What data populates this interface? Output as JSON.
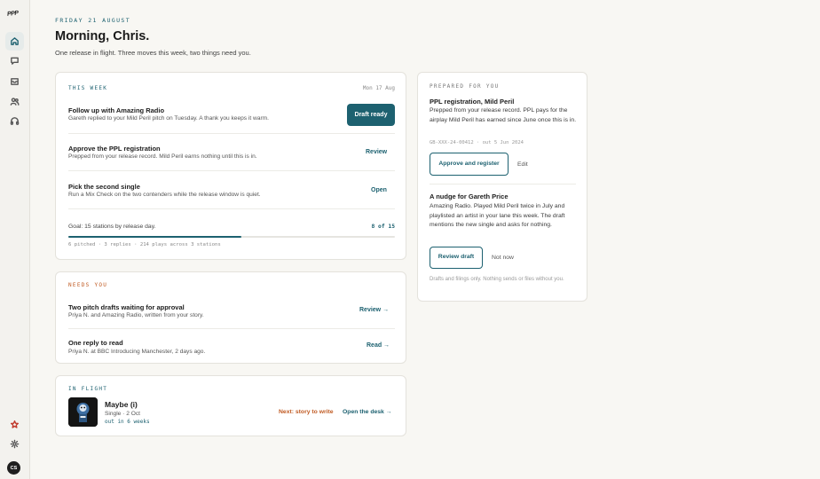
{
  "sidebar": {
    "logo_text": "PPP",
    "nav": [
      {
        "name": "home",
        "icon": "home-icon",
        "active": true
      },
      {
        "name": "messages",
        "icon": "chat-bubble-icon"
      },
      {
        "name": "inbox",
        "icon": "inbox-icon"
      },
      {
        "name": "people",
        "icon": "people-icon"
      },
      {
        "name": "support",
        "icon": "headphones-icon"
      }
    ],
    "bottom": {
      "star_icon": "star-icon",
      "settings_icon": "gear-icon",
      "avatar_initials": "CS"
    }
  },
  "header": {
    "date": "FRIDAY 21 AUGUST",
    "greeting": "Morning, Chris.",
    "subline": "One release in flight. Three moves this week, two things need you."
  },
  "this_week": {
    "label": "THIS WEEK",
    "week_date": "Mon 17 Aug",
    "items": [
      {
        "title": "Follow up with Amazing Radio",
        "subtitle": "Gareth replied to your Mild Peril pitch on Tuesday. A thank you keeps it warm.",
        "action": "Draft ready"
      },
      {
        "title": "Approve the PPL registration",
        "subtitle": "Prepped from your release record. Mild Peril earns nothing until this is in.",
        "action": "Review"
      },
      {
        "title": "Pick the second single",
        "subtitle": "Run a Mix Check on the two contenders while the release window is quiet.",
        "action": "Open"
      }
    ],
    "goal": {
      "text": "Goal: 15 stations by release day.",
      "count": "8 of 15",
      "progress": 0.53,
      "stats": "6 pitched · 3 replies · 214 plays across 3 stations"
    }
  },
  "needs_you": {
    "label": "NEEDS YOU",
    "items": [
      {
        "title": "Two pitch drafts waiting for approval",
        "subtitle": "Priya N. and Amazing Radio, written from your story.",
        "action": "Review →"
      },
      {
        "title": "One reply to read",
        "subtitle": "Priya N. at BBC Introducing Manchester, 2 days ago.",
        "action": "Read →"
      }
    ]
  },
  "in_flight": {
    "label": "IN FLIGHT",
    "cover_icon": "album-cover-icon",
    "title": "Maybe (i)",
    "meta": "Single · 2 Oct",
    "countdown": "out in 6 weeks",
    "next_step": "Next: story to write",
    "open_link": "Open the desk →"
  },
  "prepared": {
    "label": "PREPARED FOR YOU",
    "items": [
      {
        "title": "PPL registration, Mild Peril",
        "body": "Prepped from your release record. PPL pays for the airplay Mild Peril has earned since June once this is in.",
        "code": "GB-XXX-24-00412 · out 5 Jun 2024",
        "primary": "Approve and register",
        "secondary": "Edit"
      },
      {
        "title": "A nudge for Gareth Price",
        "body": "Amazing Radio. Played Mild Peril twice in July and playlisted an artist in your lane this week. The draft mentions the new single and asks for nothing.",
        "primary": "Review draft",
        "secondary": "Not now"
      }
    ],
    "footnote": "Drafts and filings only. Nothing sends or files without you."
  },
  "colors": {
    "accent": "#1d6170",
    "warning": "#c05a22",
    "background": "#f8f7f3"
  }
}
